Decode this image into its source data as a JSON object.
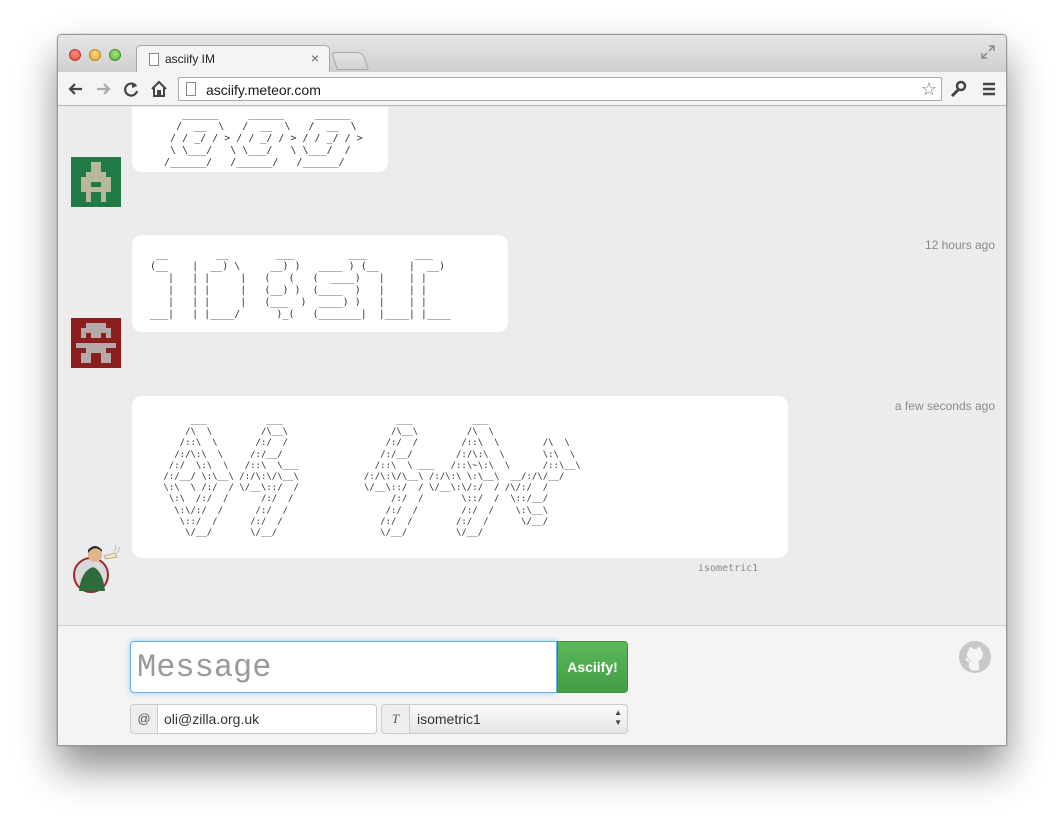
{
  "browser": {
    "tab_title": "asciify IM",
    "tab_close": "×",
    "url": "asciify.meteor.com",
    "star": "☆"
  },
  "messages": [
    {
      "ascii": "     ______     ______     ______\n    /  __  \\   /  __  \\   /  __  \\\n   / / _/ / > / / _/ / > / / _/ / >\n   \\ \\___/   \\ \\___/   \\ \\___/  /\n  /______/   /______/   /______/",
      "timestamp": "",
      "avatar": "green-robot-avatar",
      "font_label": ""
    },
    {
      "ascii": " __        __        ___         ___        ___\n(__    |  __) \\     __) )   ____ ) (__     |  __)\n   |   | |     |   (   (   (  ____)   |    | |\n   |   | |     |   (__) )  (____  )   |    | |\n   |   | |     |   (___  )  ____) )   |    | |\n___|   | |____/      )_(   (_______|  |____| |____",
      "timestamp": "12 hours ago",
      "avatar": "red-robot-avatar",
      "font_label": ""
    },
    {
      "ascii": "      ___           ___                     ___           ___\n     /\\  \\         /\\__\\                   /\\__\\         /\\  \\\n    /::\\  \\       /:/  /                  /:/  /        /::\\  \\        /\\  \\\n   /:/\\:\\  \\     /:/__/                  /:/__/        /:/\\:\\  \\       \\:\\  \\\n  /:/  \\:\\  \\   /::\\  \\___              /::\\  \\ ___   /::\\~\\:\\  \\      /::\\__\\\n /:/__/ \\:\\__\\ /:/\\:\\/\\__\\            /:/\\:\\/\\__\\ /:/\\:\\ \\:\\__\\  __/:/\\/__/\n \\:\\  \\ /:/  / \\/__\\::/  /            \\/__\\::/  / \\/__\\:\\/:/  / /\\/:/  /\n  \\:\\  /:/  /      /:/  /                  /:/  /       \\::/  /  \\::/__/\n   \\:\\/:/  /      /:/  /                  /:/  /        /:/  /    \\:\\__\\\n    \\::/  /      /:/  /                  /:/  /        /:/  /      \\/__/\n     \\/__/       \\/__/                   \\/__/         \\/__/",
      "timestamp": "a few seconds ago",
      "avatar": "bearded-man-avatar",
      "font_label": "isometric1"
    }
  ],
  "compose": {
    "message_placeholder": "Message",
    "asciify_label": "Asciify!",
    "at_label": "@",
    "email_value": "oli@zilla.org.uk",
    "t_label": "T",
    "font_value": "isometric1",
    "select_up": "▲",
    "select_down": "▼"
  },
  "colors": {
    "accent_button": "#5cb85c",
    "focus_border": "#66afe9"
  },
  "icons": [
    "back-icon",
    "forward-icon",
    "reload-icon",
    "home-icon",
    "page-icon",
    "star-icon",
    "wrench-icon",
    "menu-icon",
    "github-icon",
    "fullscreen-icon"
  ]
}
